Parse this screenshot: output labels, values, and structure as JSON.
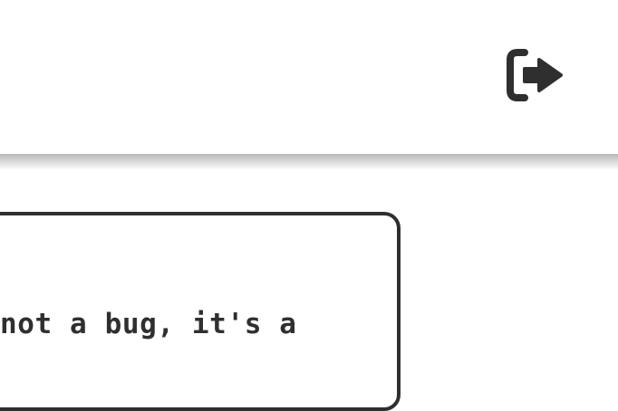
{
  "header": {
    "logout_icon": "sign-out-icon"
  },
  "card": {
    "text": "not a bug, it's a"
  },
  "colors": {
    "background": "#ffffff",
    "foreground": "#2f2f2f"
  }
}
